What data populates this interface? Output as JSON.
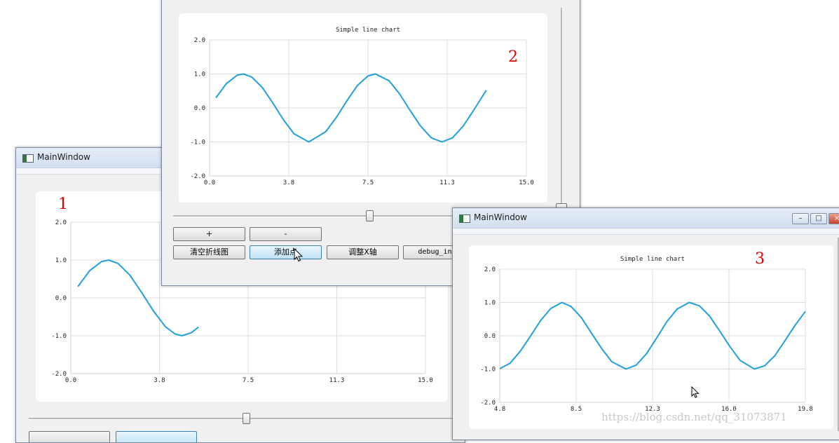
{
  "window1": {
    "title": "MainWindow",
    "annotation": "1",
    "slider_value": 0.5,
    "chart": {
      "title": "",
      "x_ticks": [
        "0.0",
        "3.8",
        "7.5",
        "11.3",
        "15.0"
      ],
      "y_ticks": [
        "2.0",
        "1.0",
        "0.0",
        "-1.0",
        "-2.0"
      ]
    }
  },
  "window2": {
    "annotation": "2",
    "horizontal_slider_value": 0.5,
    "vertical_slider_value": 0.0,
    "chart": {
      "title": "Simple line chart",
      "x_ticks": [
        "0.0",
        "3.8",
        "7.5",
        "11.3",
        "15.0"
      ],
      "y_ticks": [
        "2.0",
        "1.0",
        "0.0",
        "-1.0",
        "-2.0"
      ]
    },
    "buttons": {
      "plus": "+",
      "minus": "-",
      "clear": "清空折线图",
      "add": "添加点",
      "adjust_x": "调整X轴",
      "debug": "debug_info"
    }
  },
  "window3": {
    "title": "MainWindow",
    "annotation": "3",
    "chart": {
      "title": "Simple line chart",
      "x_ticks": [
        "4.8",
        "8.5",
        "12.3",
        "16.0",
        "19.8"
      ],
      "y_ticks": [
        "2.0",
        "1.0",
        "0.0",
        "-1.0",
        "-2.0"
      ]
    },
    "caption_buttons": {
      "minimize": "–",
      "maximize": "□",
      "close": "×"
    }
  },
  "watermark": "https://blog.csdn.net/qq_31073871",
  "colors": {
    "series": "#209fdf",
    "grid": "#dcdcdc",
    "annotation": "#e00000"
  },
  "chart_data": [
    {
      "type": "line",
      "title": "",
      "xlim": [
        0,
        15
      ],
      "ylim": [
        -2,
        2
      ],
      "grid": true,
      "series": [
        {
          "values": [
            [
              0.3,
              0.3
            ],
            [
              0.8,
              0.72
            ],
            [
              1.3,
              0.96
            ],
            [
              1.6,
              1.0
            ],
            [
              2.0,
              0.91
            ],
            [
              2.5,
              0.6
            ],
            [
              3.0,
              0.14
            ],
            [
              3.5,
              -0.35
            ],
            [
              4.0,
              -0.76
            ],
            [
              4.4,
              -0.95
            ],
            [
              4.7,
              -1.0
            ],
            [
              5.1,
              -0.92
            ],
            [
              5.4,
              -0.77
            ]
          ]
        }
      ]
    },
    {
      "type": "line",
      "title": "Simple line chart",
      "xlim": [
        0,
        15
      ],
      "ylim": [
        -2,
        2
      ],
      "grid": true,
      "series": [
        {
          "values": [
            [
              0.3,
              0.3
            ],
            [
              0.8,
              0.72
            ],
            [
              1.3,
              0.96
            ],
            [
              1.6,
              1.0
            ],
            [
              2.0,
              0.91
            ],
            [
              2.5,
              0.6
            ],
            [
              3.0,
              0.14
            ],
            [
              3.5,
              -0.35
            ],
            [
              4.0,
              -0.76
            ],
            [
              4.7,
              -1.0
            ],
            [
              5.5,
              -0.7
            ],
            [
              6.0,
              -0.28
            ],
            [
              6.5,
              0.21
            ],
            [
              7.0,
              0.66
            ],
            [
              7.5,
              0.94
            ],
            [
              7.85,
              1.0
            ],
            [
              8.5,
              0.8
            ],
            [
              9.0,
              0.41
            ],
            [
              9.5,
              -0.08
            ],
            [
              10.0,
              -0.54
            ],
            [
              10.5,
              -0.88
            ],
            [
              11.0,
              -1.0
            ],
            [
              11.5,
              -0.88
            ],
            [
              12.0,
              -0.54
            ],
            [
              12.5,
              -0.07
            ],
            [
              13.0,
              0.42
            ],
            [
              13.1,
              0.52
            ]
          ]
        }
      ]
    },
    {
      "type": "line",
      "title": "Simple line chart",
      "xlim": [
        4.8,
        19.8
      ],
      "ylim": [
        -2,
        2
      ],
      "grid": true,
      "series": [
        {
          "values": [
            [
              4.8,
              -0.99
            ],
            [
              5.3,
              -0.83
            ],
            [
              5.8,
              -0.47
            ],
            [
              6.3,
              -0.02
            ],
            [
              6.8,
              0.45
            ],
            [
              7.3,
              0.82
            ],
            [
              7.85,
              1.0
            ],
            [
              8.3,
              0.88
            ],
            [
              8.8,
              0.55
            ],
            [
              9.3,
              0.08
            ],
            [
              9.8,
              -0.38
            ],
            [
              10.3,
              -0.78
            ],
            [
              11.0,
              -1.0
            ],
            [
              11.5,
              -0.88
            ],
            [
              12.0,
              -0.54
            ],
            [
              12.5,
              -0.07
            ],
            [
              13.0,
              0.42
            ],
            [
              13.5,
              0.8
            ],
            [
              14.1,
              1.0
            ],
            [
              14.6,
              0.9
            ],
            [
              15.1,
              0.59
            ],
            [
              15.6,
              0.14
            ],
            [
              16.1,
              -0.33
            ],
            [
              16.6,
              -0.74
            ],
            [
              17.3,
              -1.0
            ],
            [
              17.8,
              -0.9
            ],
            [
              18.3,
              -0.6
            ],
            [
              18.8,
              -0.15
            ],
            [
              19.3,
              0.32
            ],
            [
              19.8,
              0.73
            ]
          ]
        }
      ]
    }
  ]
}
